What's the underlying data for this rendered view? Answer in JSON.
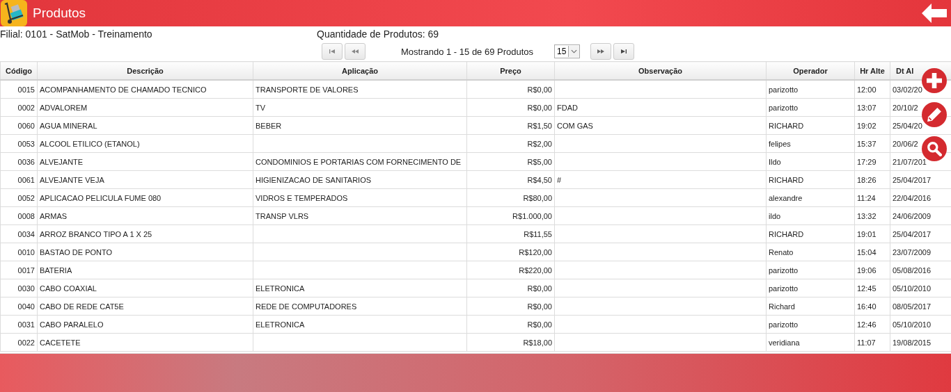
{
  "header": {
    "title": "Produtos"
  },
  "info": {
    "branch": "Filial: 0101 - SatMob - Treinamento",
    "count": "Quantidade de Produtos: 69"
  },
  "pager": {
    "status": "Mostrando 1 - 15 de 69 Produtos",
    "page_size": "15"
  },
  "table": {
    "columns": [
      "Código",
      "Descrição",
      "Aplicação",
      "Preço",
      "Observação",
      "Operador",
      "Hr Alte",
      "Dt Al"
    ],
    "rows": [
      {
        "codigo": "0015",
        "descricao": "ACOMPANHAMENTO DE CHAMADO TECNICO",
        "aplicacao": "TRANSPORTE DE VALORES",
        "preco": "R$0,00",
        "operador": "parizotto",
        "hr": "12:00",
        "dt": "03/02/20"
      },
      {
        "codigo": "0002",
        "descricao": "ADVALOREM",
        "aplicacao": "TV",
        "preco": "R$0,00",
        "observacao": "FDAD",
        "operador": "parizotto",
        "hr": "13:07",
        "dt": "20/10/2"
      },
      {
        "codigo": "0060",
        "descricao": "AGUA MINERAL",
        "aplicacao": "BEBER",
        "preco": "R$1,50",
        "observacao": "COM GAS",
        "operador": "RICHARD",
        "hr": "19:02",
        "dt": "25/04/20"
      },
      {
        "codigo": "0053",
        "descricao": "ALCOOL ETILICO (ETANOL)",
        "preco": "R$2,00",
        "operador": "felipes",
        "hr": "15:37",
        "dt": "20/06/2"
      },
      {
        "codigo": "0036",
        "descricao": "ALVEJANTE",
        "aplicacao": "CONDOMINIOS E PORTARIAS COM FORNECIMENTO DE",
        "preco": "R$5,00",
        "operador": "Ildo",
        "hr": "17:29",
        "dt": "21/07/201"
      },
      {
        "codigo": "0061",
        "descricao": "ALVEJANTE VEJA",
        "aplicacao": "HIGIENIZACAO DE SANITARIOS",
        "preco": "R$4,50",
        "observacao": "#",
        "operador": "RICHARD",
        "hr": "18:26",
        "dt": "25/04/2017"
      },
      {
        "codigo": "0052",
        "descricao": "APLICACAO PELICULA FUME 080",
        "aplicacao": "VIDROS E TEMPERADOS",
        "preco": "R$80,00",
        "operador": "alexandre",
        "hr": "11:24",
        "dt": "22/04/2016"
      },
      {
        "codigo": "0008",
        "descricao": "ARMAS",
        "aplicacao": "TRANSP VLRS",
        "preco": "R$1.000,00",
        "operador": "ildo",
        "hr": "13:32",
        "dt": "24/06/2009"
      },
      {
        "codigo": "0034",
        "descricao": "ARROZ BRANCO TIPO A 1 X 25",
        "preco": "R$11,55",
        "operador": "RICHARD",
        "hr": "19:01",
        "dt": "25/04/2017"
      },
      {
        "codigo": "0010",
        "descricao": "BASTAO DE PONTO",
        "preco": "R$120,00",
        "operador": "Renato",
        "hr": "15:04",
        "dt": "23/07/2009"
      },
      {
        "codigo": "0017",
        "descricao": "BATERIA",
        "preco": "R$220,00",
        "operador": "parizotto",
        "hr": "19:06",
        "dt": "05/08/2016"
      },
      {
        "codigo": "0030",
        "descricao": "CABO COAXIAL",
        "aplicacao": "ELETRONICA",
        "preco": "R$0,00",
        "operador": "parizotto",
        "hr": "12:45",
        "dt": "05/10/2010"
      },
      {
        "codigo": "0040",
        "descricao": "CABO DE REDE CAT5E",
        "aplicacao": "REDE DE COMPUTADORES",
        "preco": "R$0,00",
        "operador": "Richard",
        "hr": "16:40",
        "dt": "08/05/2017"
      },
      {
        "codigo": "0031",
        "descricao": "CABO PARALELO",
        "aplicacao": "ELETRONICA",
        "preco": "R$0,00",
        "operador": "parizotto",
        "hr": "12:46",
        "dt": "05/10/2010"
      },
      {
        "codigo": "0022",
        "descricao": "CACETETE",
        "preco": "R$18,00",
        "operador": "veridiana",
        "hr": "11:07",
        "dt": "19/08/2015"
      }
    ]
  }
}
